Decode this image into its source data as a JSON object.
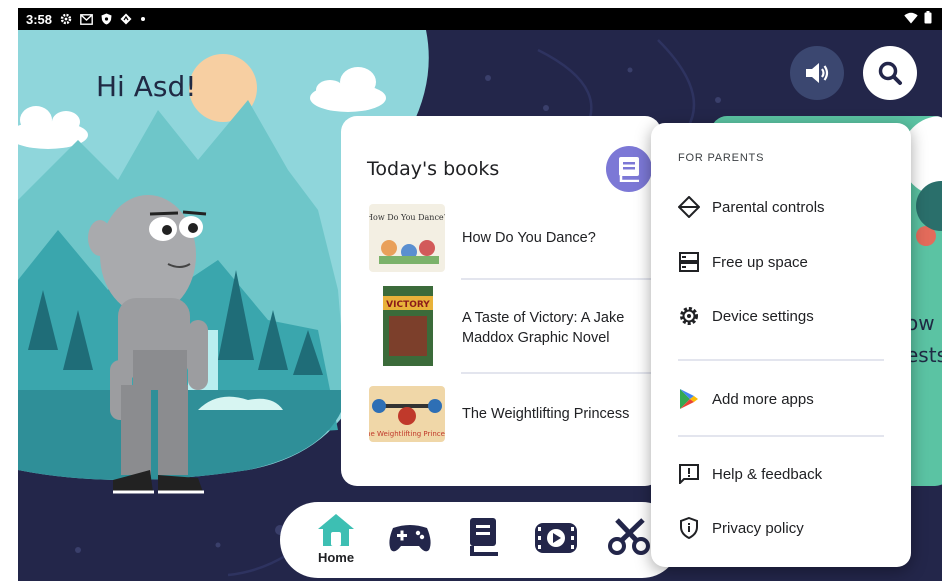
{
  "status_bar": {
    "time": "3:58",
    "icons": [
      "gear-icon",
      "gmail-icon",
      "shield-icon",
      "location-icon",
      "dot-icon"
    ],
    "right_icons": [
      "wifi-icon",
      "battery-icon"
    ]
  },
  "greeting": "Hi Asd!",
  "books_card": {
    "title": "Today's books",
    "books": [
      {
        "title": "How Do You Dance?",
        "cover_text": "How Do You Dance?"
      },
      {
        "title": "A Taste of Victory: A Jake Maddox Graphic Novel",
        "cover_text": "VICTORY"
      },
      {
        "title": "The Weightlifting Princess",
        "cover_text": "The Weightlifting Princess"
      }
    ]
  },
  "peek_card": {
    "line1": "ow",
    "line2": "ests"
  },
  "bottom_nav": {
    "items": [
      {
        "label": "Home",
        "icon": "home-icon"
      },
      {
        "label": "",
        "icon": "gamepad-icon"
      },
      {
        "label": "",
        "icon": "book-icon"
      },
      {
        "label": "",
        "icon": "video-icon"
      },
      {
        "label": "",
        "icon": "scissors-icon"
      }
    ]
  },
  "menu": {
    "header": "FOR PARENTS",
    "items": [
      {
        "label": "Parental controls",
        "icon": "diamond-icon"
      },
      {
        "label": "Free up space",
        "icon": "storage-icon"
      },
      {
        "label": "Device settings",
        "icon": "settings-gear-icon"
      },
      {
        "label": "Add more apps",
        "icon": "play-store-icon"
      },
      {
        "label": "Help & feedback",
        "icon": "feedback-icon"
      },
      {
        "label": "Privacy policy",
        "icon": "privacy-shield-icon"
      }
    ]
  },
  "colors": {
    "sky": "#8fd6db",
    "night": "#23264a",
    "accent_purple": "#7c78d6",
    "accent_teal": "#3dbfb3",
    "peek_green": "#5bc3a3"
  }
}
